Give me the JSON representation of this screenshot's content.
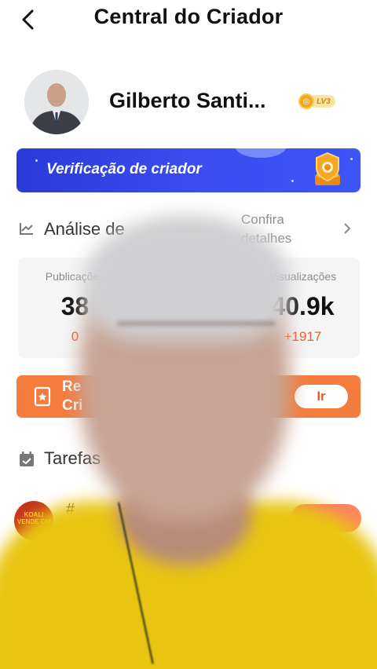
{
  "header": {
    "title": "Central do Criador",
    "back_icon": "chevron-left-icon"
  },
  "profile": {
    "name": "Gilberto Santi...",
    "level_badge": "LV3"
  },
  "verification_banner": {
    "label": "Verificação de criador"
  },
  "analysis": {
    "title": "Análise de",
    "details_link": "Confira detalhes"
  },
  "stats": [
    {
      "label": "Publicações",
      "value": "38",
      "delta": "0"
    },
    {
      "label": "",
      "value": "",
      "delta": ""
    },
    {
      "label": "Visualizações",
      "value": "40.9k",
      "delta": "+1917"
    }
  ],
  "task_banner": {
    "text_line1": "Re",
    "text_line2": "Cri",
    "button_label": "Ir"
  },
  "tasks": {
    "title": "Tarefas",
    "item_tag": "#",
    "item_thumb_text": "KOALI VENDE CM"
  },
  "colors": {
    "accent_orange": "#f15a2b",
    "banner_blue": "#3a4ef2",
    "badge_gold": "#f2a81d"
  }
}
